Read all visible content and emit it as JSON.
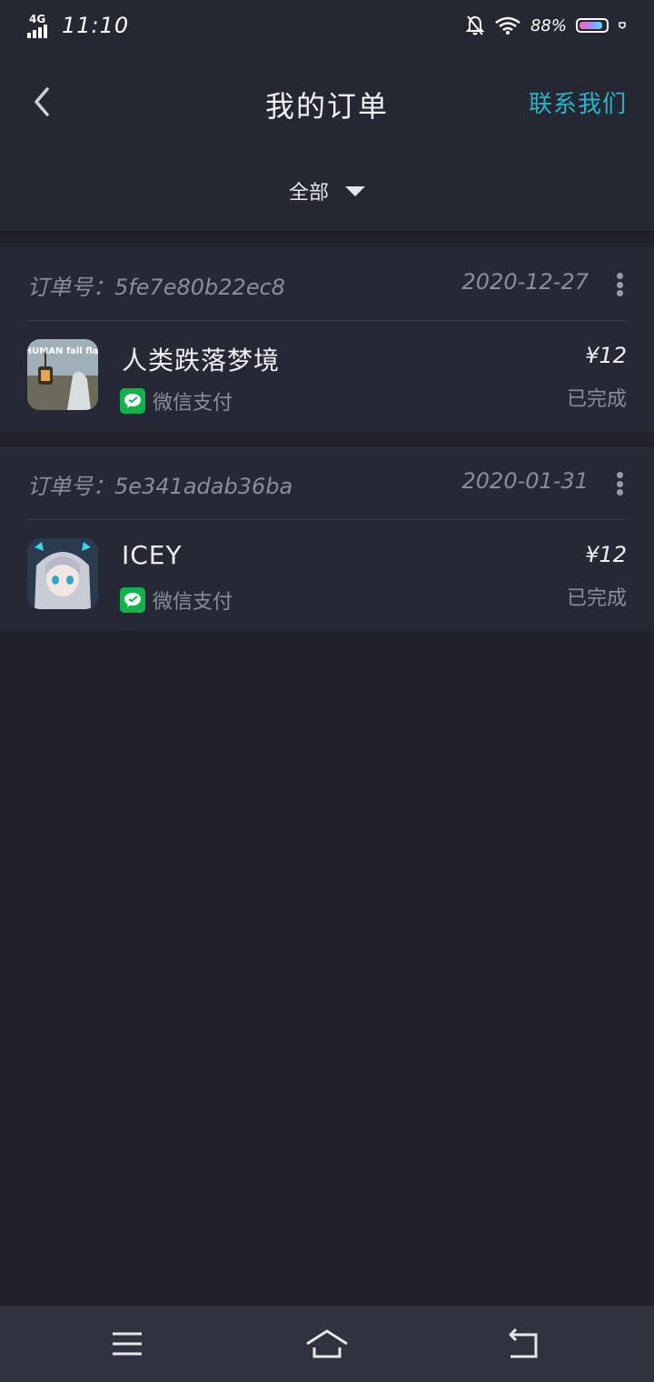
{
  "status_bar": {
    "network": "4G",
    "time": "11:10",
    "battery_percent": "88%",
    "battery_level": 0.88,
    "icons": [
      "signal-icon",
      "bell-muted-icon",
      "wifi-icon",
      "battery-icon"
    ]
  },
  "header": {
    "title": "我的订单",
    "contact_label": "联系我们",
    "filter_label": "全部"
  },
  "orders": [
    {
      "order_no": "订单号：5fe7e80b22ec8",
      "date": "2020-12-27",
      "game_name": "人类跌落梦境",
      "payment": "微信支付",
      "price": "¥12",
      "status": "已完成",
      "icon_text": "HUMAN fall flat"
    },
    {
      "order_no": "订单号：5e341adab36ba",
      "date": "2020-01-31",
      "game_name": "ICEY",
      "payment": "微信支付",
      "price": "¥12",
      "status": "已完成"
    }
  ],
  "colors": {
    "accent": "#24b5c4",
    "background": "#20212b",
    "card": "#262835",
    "wechat_green": "#12b34a"
  },
  "nav_bar": {
    "icons": [
      "menu-icon",
      "home-icon",
      "back-nav-icon"
    ]
  }
}
